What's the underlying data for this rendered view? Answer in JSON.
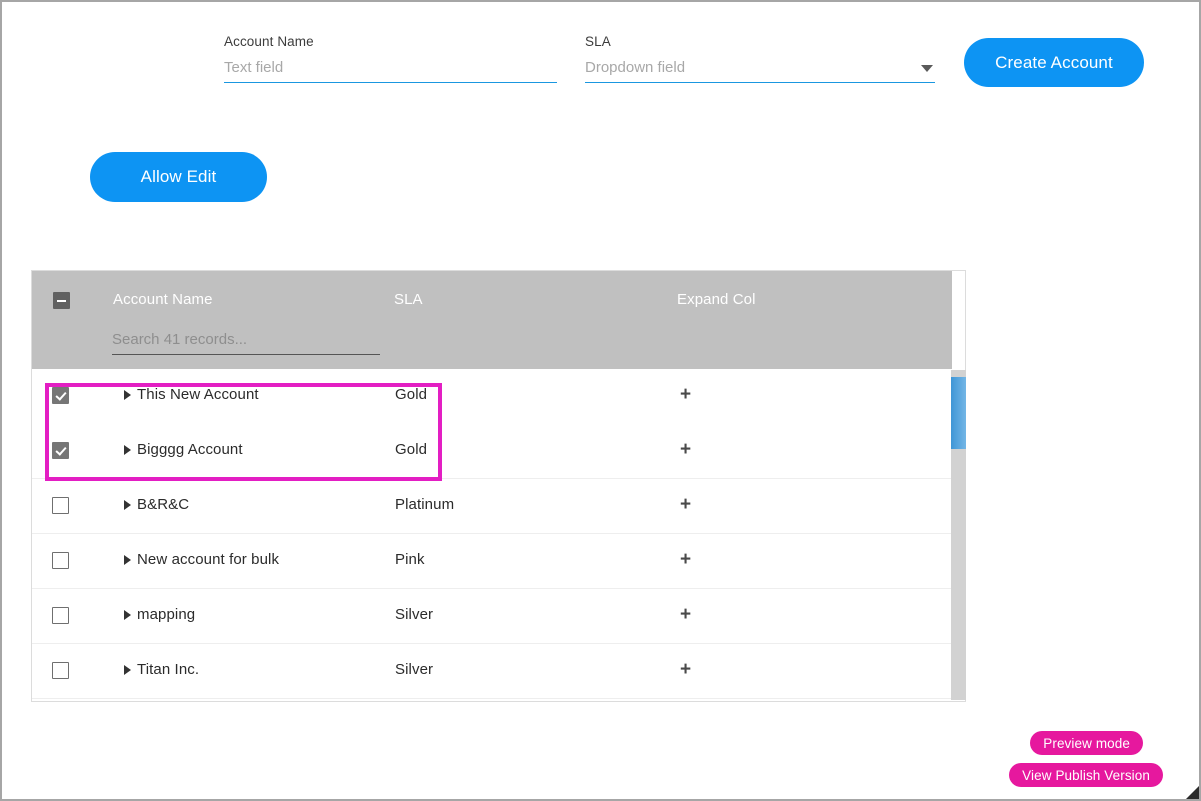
{
  "form": {
    "account_name": {
      "label": "Account Name",
      "placeholder": "Text field",
      "value": ""
    },
    "sla": {
      "label": "SLA",
      "placeholder": "Dropdown field",
      "value": "",
      "caret_icon": "chevron-down-icon"
    },
    "create_button": "Create Account",
    "allow_edit_button": "Allow Edit"
  },
  "table": {
    "headers": {
      "account_name": "Account Name",
      "sla": "SLA",
      "expand_col": "Expand Col"
    },
    "select_all_state": "indeterminate",
    "search_placeholder": "Search 41 records...",
    "search_value": "",
    "record_count": 41,
    "expand_icon": "+",
    "rows": [
      {
        "checked": true,
        "caret": "caret-right-icon",
        "name": "This New Account",
        "sla": "Gold",
        "expand": "+"
      },
      {
        "checked": true,
        "caret": "caret-right-icon",
        "name": "Bigggg Account",
        "sla": "Gold",
        "expand": "+"
      },
      {
        "checked": false,
        "caret": "caret-right-icon",
        "name": "B&R&C",
        "sla": "Platinum",
        "expand": "+"
      },
      {
        "checked": false,
        "caret": "caret-right-icon",
        "name": "New account for bulk",
        "sla": "Pink",
        "expand": "+"
      },
      {
        "checked": false,
        "caret": "caret-right-icon",
        "name": "mapping",
        "sla": "Silver",
        "expand": "+"
      },
      {
        "checked": false,
        "caret": "caret-right-icon",
        "name": "Titan Inc.",
        "sla": "Silver",
        "expand": "+"
      }
    ]
  },
  "badges": {
    "preview_mode": "Preview mode",
    "view_publish_version": "View Publish Version"
  },
  "colors": {
    "accent_blue": "#0d94f3",
    "header_gray": "#c0c0c0",
    "highlight_magenta": "#e31ec3",
    "badge_pink": "#e6189e",
    "scroll_thumb_blue": "#3f96d6"
  }
}
